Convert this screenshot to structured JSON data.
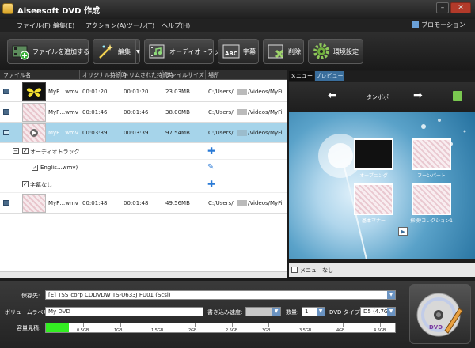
{
  "window": {
    "title": "Aiseesoft DVD 作成",
    "minimize": "–",
    "close": "✕"
  },
  "menu": {
    "items": [
      "ファイル(F)",
      "編集(E)",
      "アクション(A)",
      "ツール(T)",
      "ヘルプ(H)"
    ],
    "promo": "プロモーション"
  },
  "toolbar": {
    "add_file": "ファイルを追加する",
    "edit": "編集",
    "audio_track": "オーディオトラック",
    "subtitle": "字幕",
    "delete": "削除",
    "settings": "環境設定"
  },
  "file_list": {
    "headers": [
      "ファイル名",
      "オリジナル持続時",
      "トリムされた持続時",
      "ファイルサイズ",
      "場所"
    ],
    "rows": [
      {
        "name": "MyF…wmv",
        "orig": "00:01:20",
        "trim": "00:01:20",
        "size": "23.03MB",
        "path": "C:/Users/",
        "path2": "/Videos/MyFi"
      },
      {
        "name": "MyF…wmv",
        "orig": "00:01:46",
        "trim": "00:01:46",
        "size": "38.00MB",
        "path": "C:/Users/",
        "path2": "/Videos/MyFi"
      },
      {
        "name": "MyF…wmv",
        "orig": "00:03:39",
        "trim": "00:03:39",
        "size": "97.54MB",
        "path": "C:/Users/",
        "path2": "/Videos/MyFi"
      },
      {
        "name": "MyF…wmv",
        "orig": "00:01:48",
        "trim": "00:01:48",
        "size": "49.56MB",
        "path": "C:/Users/",
        "path2": "/Videos/MyFi"
      }
    ],
    "audio_track_label": "オーディオトラック",
    "audio_item": "Englis…wmv)",
    "no_subtitle": "字幕なし"
  },
  "preview": {
    "tab_menu": "メニュー",
    "tab_preview": "プレビュー",
    "template_name": "タンポポ",
    "items": [
      "オープニング",
      "フーンパート",
      "基本マナー",
      "探検/コレクション1"
    ],
    "no_menu": "メニューなし"
  },
  "bottom": {
    "save_label": "保存先:",
    "save_value": "[E] TSSTcorp CDDVDW TS-U633J FU01 (Scsi)",
    "volume_label": "ボリュームラベル",
    "volume_value": "My DVD",
    "write_speed_label": "書き込み速度:",
    "quantity_label": "数量:",
    "quantity_value": "1",
    "dvd_type_label": "DVD タイプ:",
    "dvd_type_value": "D5 (4.7G)",
    "capacity_label": "容量見積:",
    "capacity_fraction": 0.066,
    "ticks": [
      "0.5GB",
      "1GB",
      "1.5GB",
      "2GB",
      "2.5GB",
      "3GB",
      "3.5GB",
      "4GB",
      "4.5GB"
    ]
  },
  "colors": {
    "accent": "#3a6e9c",
    "selected_row": "#a6d4ea",
    "capacity": "#33ee22"
  }
}
